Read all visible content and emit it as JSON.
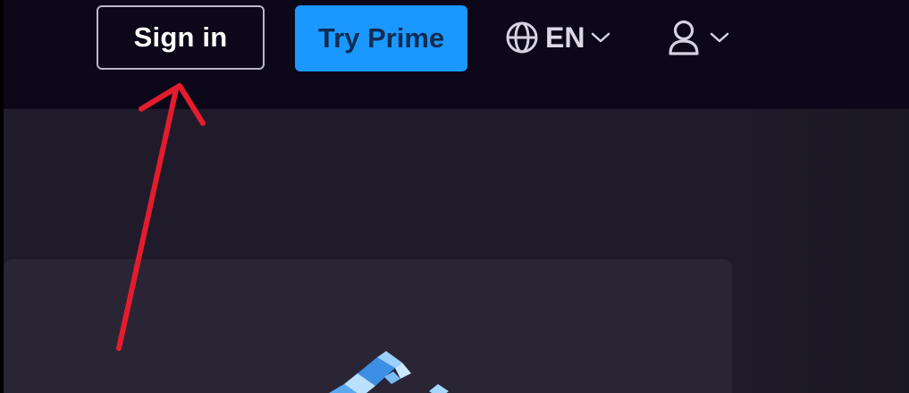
{
  "header": {
    "sign_in_label": "Sign in",
    "try_prime_label": "Try Prime",
    "language_label": "EN"
  },
  "colors": {
    "topbar_bg": "#0c0719",
    "content_bg": "#1f1b2a",
    "card_bg": "#2a2535",
    "prime_blue": "#1a98ff",
    "annotation_red": "#e41c2d"
  },
  "icons": {
    "language": "globe-icon",
    "language_caret": "chevron-down-icon",
    "account": "user-icon",
    "account_caret": "chevron-down-icon"
  }
}
